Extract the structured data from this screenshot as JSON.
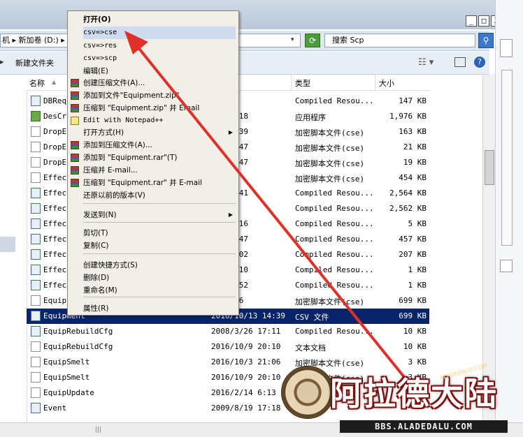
{
  "window": {
    "minimize_glyph": "_",
    "maximize_glyph": "□",
    "close_glyph": "X"
  },
  "address_bar": {
    "path": "机 ▸ 新加卷 (D:) ▸",
    "dropdown_glyph": "▾",
    "refresh_glyph": "⟳",
    "search_placeholder": "搜索 Scp",
    "search_icon": "magnifier-icon"
  },
  "toolbar": {
    "left_glyph": "▸",
    "new_folder_label": "新建文件夹",
    "view_glyph": "☷ ▾",
    "help_glyph": "?"
  },
  "columns": {
    "name": "名称",
    "modified": "期",
    "type": "类型",
    "size": "大小"
  },
  "files": [
    {
      "name": "DBRequ",
      "date": "5 2:44",
      "type": "Compiled Resou...",
      "size": "147 KB",
      "icon": "cfg"
    },
    {
      "name": "DesCry",
      "date": "16 12:18",
      "type": "应用程序",
      "size": "1,976 KB",
      "icon": "exe"
    },
    {
      "name": "DropE",
      "date": "24 13:39",
      "type": "加密脚本文件(cse)",
      "size": "163 KB",
      "icon": "doc"
    },
    {
      "name": "DropE",
      "date": "19 14:47",
      "type": "加密脚本文件(cse)",
      "size": "21 KB",
      "icon": "doc"
    },
    {
      "name": "DropE",
      "date": "19 14:47",
      "type": "加密脚本文件(cse)",
      "size": "19 KB",
      "icon": "doc"
    },
    {
      "name": "Effec",
      "date": "12:15",
      "type": "加密脚本文件(cse)",
      "size": "454 KB",
      "icon": "doc"
    },
    {
      "name": "Effec",
      "date": "14 18:41",
      "type": "Compiled Resou...",
      "size": "2,564 KB",
      "icon": "cfg"
    },
    {
      "name": "Effec",
      "date": "6 12:1",
      "type": "Compiled Resou...",
      "size": "2,562 KB",
      "icon": "cfg"
    },
    {
      "name": "Effec",
      "date": "/13 0:16",
      "type": "Compiled Resou...",
      "size": "5 KB",
      "icon": "cfg"
    },
    {
      "name": "Effec",
      "date": "26 17:47",
      "type": "Compiled Resou...",
      "size": "457 KB",
      "icon": "cfg"
    },
    {
      "name": "Effec",
      "date": "27 22:02",
      "type": "Compiled Resou...",
      "size": "207 KB",
      "icon": "cfg"
    },
    {
      "name": "Effec",
      "date": "19 19:10",
      "type": "Compiled Resou...",
      "size": "1 KB",
      "icon": "cfg"
    },
    {
      "name": "Effec",
      "date": "/26 2:52",
      "type": "Compiled Resou...",
      "size": "1 KB",
      "icon": "cfg"
    },
    {
      "name": "Equip",
      "date": "29 2:16",
      "type": "加密脚本文件(cse)",
      "size": "699 KB",
      "icon": "doc"
    },
    {
      "name": "Equipment",
      "date": "2016/10/13 14:39",
      "type": "CSV 文件",
      "size": "699 KB",
      "icon": "cfg",
      "selected": true
    },
    {
      "name": "EquipRebuildCfg",
      "date": "2008/3/26 17:11",
      "type": "Compiled Resou...",
      "size": "10 KB",
      "icon": "cfg"
    },
    {
      "name": "EquipRebuildCfg",
      "date": "2016/10/9 20:10",
      "type": "文本文档",
      "size": "10 KB",
      "icon": "doc"
    },
    {
      "name": "EquipSmelt",
      "date": "2016/10/3 21:06",
      "type": "加密脚本文件(cse)",
      "size": "3 KB",
      "icon": "doc"
    },
    {
      "name": "EquipSmelt",
      "date": "2016/10/9 20:10",
      "type": "加密脚本文件(cse)",
      "size": "3 KB",
      "icon": "doc"
    },
    {
      "name": "EquipUpdate",
      "date": "2016/2/14 6:13",
      "type": "",
      "size": "",
      "icon": "doc"
    },
    {
      "name": "Event",
      "date": "2009/8/19 17:18",
      "type": "",
      "size": "",
      "icon": "cfg"
    }
  ],
  "context_menu": {
    "items": [
      {
        "label": "打开(O)",
        "bold": true
      },
      {
        "label": "csv=>cse",
        "mono": true,
        "highlight": true
      },
      {
        "label": "csv=>res",
        "mono": true
      },
      {
        "label": "csv=>scp",
        "mono": true
      },
      {
        "label": "编辑(E)"
      },
      {
        "label": "创建压缩文件(A)...",
        "icon": "rar"
      },
      {
        "label": "添加到文件\"Equipment.zip\"",
        "icon": "rar"
      },
      {
        "label": "压缩到 \"Equipment.zip\" 并 Email",
        "icon": "rar"
      },
      {
        "label": "Edit with Notepad++",
        "icon": "np",
        "mono": true
      },
      {
        "label": "打开方式(H)",
        "submenu": true
      },
      {
        "label": "添加到压缩文件(A)...",
        "icon": "rar"
      },
      {
        "label": "添加到 \"Equipment.rar\"(T)",
        "icon": "rar"
      },
      {
        "label": "压缩并 E-mail...",
        "icon": "rar"
      },
      {
        "label": "压缩到 \"Equipment.rar\" 并 E-mail",
        "icon": "rar"
      },
      {
        "label": "还原以前的版本(V)"
      },
      {
        "label": "发送到(N)",
        "submenu": true
      },
      {
        "label": "剪切(T)"
      },
      {
        "label": "复制(C)"
      },
      {
        "label": "创建快捷方式(S)"
      },
      {
        "label": "删除(D)"
      },
      {
        "label": "重命名(M)"
      },
      {
        "label": "属性(R)"
      }
    ],
    "submenu_glyph": "▶"
  },
  "watermark": {
    "title": "阿拉德大陆",
    "subtitle": "ALADEDALU.COM",
    "url": "BBS.ALADEDALU.COM"
  },
  "colors": {
    "selection": "#0a246a",
    "arrow": "#e0302a",
    "menu_bg": "#f1efe7"
  }
}
